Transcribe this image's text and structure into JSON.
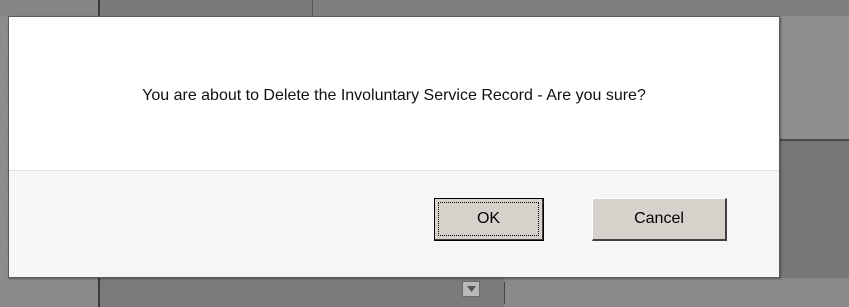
{
  "dialog": {
    "message": "You are about to Delete the Involuntary Service Record - Are you sure?",
    "ok_label": "OK",
    "cancel_label": "Cancel"
  },
  "background": {
    "dropdown_icon": "chevron-down-icon"
  },
  "colors": {
    "overlay": "#8a8a8a",
    "dialog_bg": "#ffffff",
    "footer_bg": "#f6f6f6",
    "button_face": "#d6d2cb"
  }
}
